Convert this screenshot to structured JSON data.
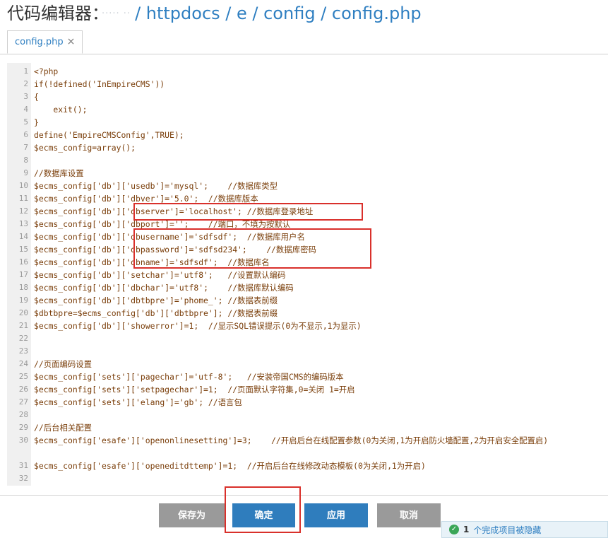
{
  "header": {
    "label": "代码编辑器：",
    "host": "·····  ··",
    "path": "/ httpdocs / e / config / config.php"
  },
  "tab": {
    "label": "config.php",
    "close": "×"
  },
  "code": [
    {
      "n": "1",
      "t": "<?php"
    },
    {
      "n": "2",
      "t": "if(!defined('InEmpireCMS'))"
    },
    {
      "n": "3",
      "t": "{"
    },
    {
      "n": "4",
      "t": "    exit();"
    },
    {
      "n": "5",
      "t": "}"
    },
    {
      "n": "6",
      "t": "define('EmpireCMSConfig',TRUE);"
    },
    {
      "n": "7",
      "t": "$ecms_config=array();"
    },
    {
      "n": "8",
      "t": ""
    },
    {
      "n": "9",
      "t": "//数据库设置"
    },
    {
      "n": "10",
      "t": "$ecms_config['db']['usedb']='mysql';    //数据库类型"
    },
    {
      "n": "11",
      "t": "$ecms_config['db']['dbver']='5.0';  //数据库版本"
    },
    {
      "n": "12",
      "t": "$ecms_config['db']['dbserver']='localhost'; //数据库登录地址"
    },
    {
      "n": "13",
      "t": "$ecms_config['db']['dbport']='';    //端口，不填为按默认"
    },
    {
      "n": "14",
      "t": "$ecms_config['db']['dbusername']='sdfsdf';  //数据库用户名"
    },
    {
      "n": "15",
      "t": "$ecms_config['db']['dbpassword']='sdfsd234';    //数据库密码"
    },
    {
      "n": "16",
      "t": "$ecms_config['db']['dbname']='sdfsdf';  //数据库名"
    },
    {
      "n": "17",
      "t": "$ecms_config['db']['setchar']='utf8';   //设置默认编码"
    },
    {
      "n": "18",
      "t": "$ecms_config['db']['dbchar']='utf8';    //数据库默认编码"
    },
    {
      "n": "19",
      "t": "$ecms_config['db']['dbtbpre']='phome_'; //数据表前缀"
    },
    {
      "n": "20",
      "t": "$dbtbpre=$ecms_config['db']['dbtbpre']; //数据表前缀"
    },
    {
      "n": "21",
      "t": "$ecms_config['db']['showerror']=1;  //显示SQL错误提示(0为不显示,1为显示)"
    },
    {
      "n": "22",
      "t": ""
    },
    {
      "n": "23",
      "t": ""
    },
    {
      "n": "24",
      "t": "//页面编码设置"
    },
    {
      "n": "25",
      "t": "$ecms_config['sets']['pagechar']='utf-8';   //安装帝国CMS的编码版本"
    },
    {
      "n": "26",
      "t": "$ecms_config['sets']['setpagechar']=1;  //页面默认字符集,0=关闭 1=开启"
    },
    {
      "n": "27",
      "t": "$ecms_config['sets']['elang']='gb'; //语言包"
    },
    {
      "n": "28",
      "t": ""
    },
    {
      "n": "29",
      "t": "//后台相关配置"
    },
    {
      "n": "30",
      "t": "$ecms_config['esafe']['openonlinesetting']=3;    //开启后台在线配置参数(0为关闭,1为开启防火墙配置,2为开启安全配置启)",
      "wrap": true
    },
    {
      "n": "31",
      "t": "$ecms_config['esafe']['openeditdttemp']=1;  //开启后台在线修改动态模板(0为关闭,1为开启)"
    },
    {
      "n": "32",
      "t": ""
    }
  ],
  "buttons": {
    "save_as": "保存为",
    "confirm": "确定",
    "apply": "应用",
    "cancel": "取消"
  },
  "toast": {
    "count": "1",
    "message": "个完成项目被隐藏"
  },
  "colors": {
    "accent": "#2f7fc1",
    "highlight": "#d9302b",
    "button_blue": "#2f7dbd",
    "button_gray": "#9a9a9a"
  }
}
